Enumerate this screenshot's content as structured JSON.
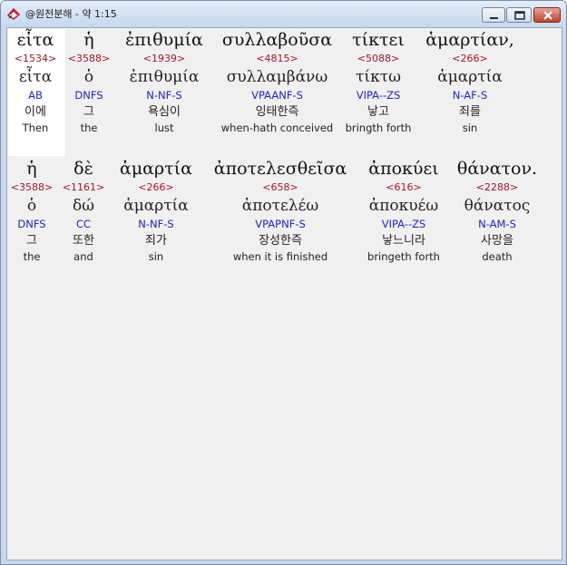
{
  "window": {
    "title": "@원전분해 - 약 1:15",
    "icon": "bible-book-icon",
    "controls": [
      "minimize-icon",
      "maximize-icon",
      "close-icon"
    ]
  },
  "verse": {
    "lines": [
      {
        "words": [
          {
            "greek": "εἶτα",
            "strong": "<1534>",
            "lemma": "εἶτα",
            "morph": "AB",
            "korean": "이에",
            "english": "Then"
          },
          {
            "greek": "ἡ",
            "strong": "<3588>",
            "lemma": "ὁ",
            "morph": "DNFS",
            "korean": "그",
            "english": "the"
          },
          {
            "greek": "ἐπιθυμία",
            "strong": "<1939>",
            "lemma": "ἐπιθυμία",
            "morph": "N-NF-S",
            "korean": "욕심이",
            "english": "lust"
          },
          {
            "greek": "συλλαβοῦσα",
            "strong": "<4815>",
            "lemma": "συλλαμβάνω",
            "morph": "VPAANF-S",
            "korean": "잉태한즉",
            "english": "when-hath conceived"
          },
          {
            "greek": "τίκτει",
            "strong": "<5088>",
            "lemma": "τίκτω",
            "morph": "VIPA--ZS",
            "korean": "낳고",
            "english": "bringth forth"
          },
          {
            "greek": "ἁμαρτίαν,",
            "strong": "<266>",
            "lemma": "ἁμαρτία",
            "morph": "N-AF-S",
            "korean": "죄를",
            "english": "sin"
          }
        ]
      },
      {
        "words": [
          {
            "greek": "ἡ",
            "strong": "<3588>",
            "lemma": "ὁ",
            "morph": "DNFS",
            "korean": "그",
            "english": "the"
          },
          {
            "greek": "δὲ",
            "strong": "<1161>",
            "lemma": "δώ",
            "morph": "CC",
            "korean": "또한",
            "english": "and"
          },
          {
            "greek": "ἁμαρτία",
            "strong": "<266>",
            "lemma": "ἁμαρτία",
            "morph": "N-NF-S",
            "korean": "죄가",
            "english": "sin"
          },
          {
            "greek": "ἀποτελεσθεῖσα",
            "strong": "<658>",
            "lemma": "ἀποτελέω",
            "morph": "VPAPNF-S",
            "korean": "장성한즉",
            "english": "when it is finished"
          },
          {
            "greek": "ἀποκύει",
            "strong": "<616>",
            "lemma": "ἀποκυέω",
            "morph": "VIPA--ZS",
            "korean": "낳느니라",
            "english": "bringeth forth"
          },
          {
            "greek": "θάνατον.",
            "strong": "<2288>",
            "lemma": "θάνατος",
            "morph": "N-AM-S",
            "korean": "사망을",
            "english": "death"
          }
        ]
      }
    ]
  }
}
